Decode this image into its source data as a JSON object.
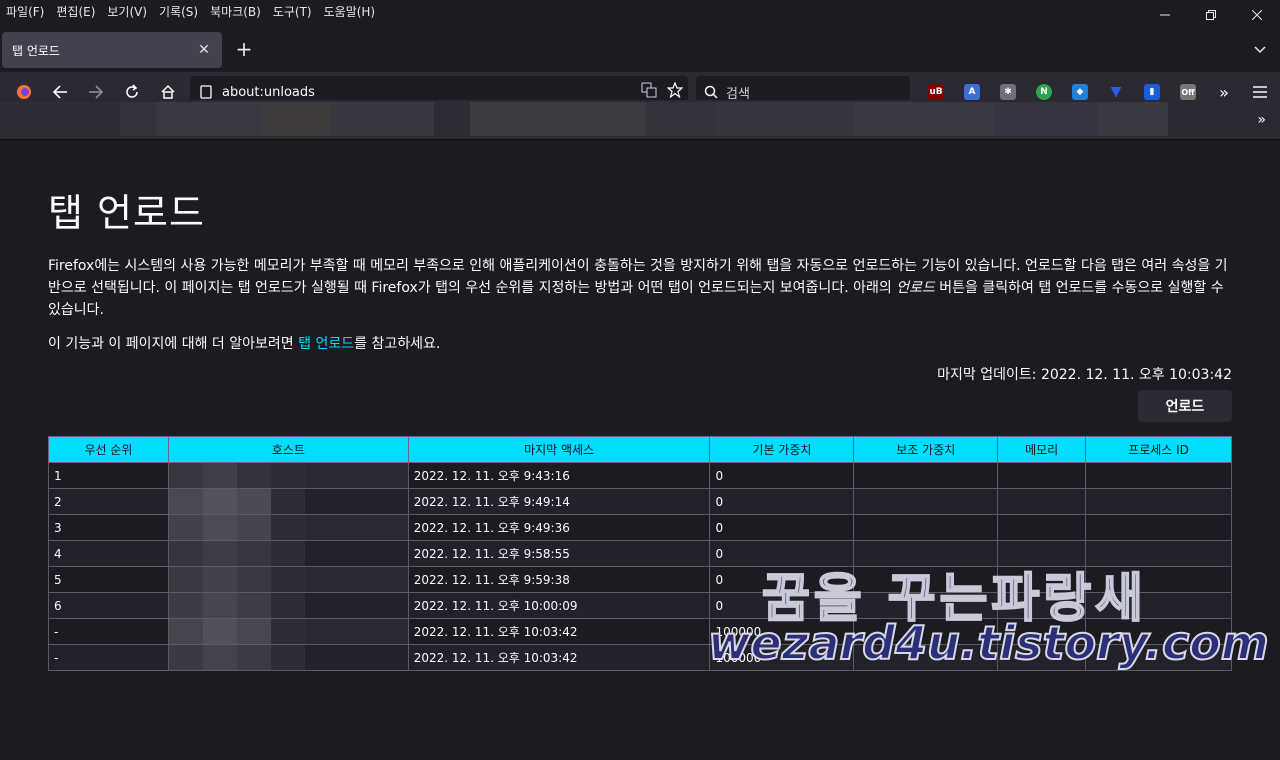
{
  "menu": [
    "파일(F)",
    "편집(E)",
    "보기(V)",
    "기록(S)",
    "북마크(B)",
    "도구(T)",
    "도움말(H)"
  ],
  "tab": {
    "title": "탭 언로드"
  },
  "url": "about:unloads",
  "search": {
    "placeholder": "검색"
  },
  "content": {
    "title": "탭 언로드",
    "desc_before": "Firefox에는 시스템의 사용 가능한 메모리가 부족할 때 메모리 부족으로 인해 애플리케이션이 충돌하는 것을 방지하기 위해 탭을 자동으로 언로드하는 기능이 있습니다. 언로드할 다음 탭은 여러 속성을 기반으로 선택됩니다. 이 페이지는 탭 언로드가 실행될 때 Firefox가 탭의 우선 순위를 지정하는 방법과 어떤 탭이 언로드되는지 보여줍니다. 아래의 ",
    "desc_em": "언로드",
    "desc_after": " 버튼을 클릭하여 탭 언로드를 수동으로 실행할 수 있습니다.",
    "learn_before": "이 기능과 이 페이지에 대해 더 알아보려면 ",
    "learn_link": "탭 언로드",
    "learn_after": "를 참고하세요.",
    "updated": "마지막 업데이트: 2022. 12. 11. 오후 10:03:42",
    "unload_button": "언로드"
  },
  "table": {
    "headers": [
      "우선 순위",
      "호스트",
      "마지막 액세스",
      "기본 가중치",
      "보조 가중치",
      "메모리",
      "프로세스 ID"
    ],
    "rows": [
      [
        "1",
        "",
        "2022. 12. 11. 오후 9:43:16",
        "0",
        "",
        "",
        ""
      ],
      [
        "2",
        "",
        "2022. 12. 11. 오후 9:49:14",
        "0",
        "",
        "",
        ""
      ],
      [
        "3",
        "",
        "2022. 12. 11. 오후 9:49:36",
        "0",
        "",
        "",
        ""
      ],
      [
        "4",
        "",
        "2022. 12. 11. 오후 9:58:55",
        "0",
        "",
        "",
        ""
      ],
      [
        "5",
        "",
        "2022. 12. 11. 오후 9:59:38",
        "0",
        "",
        "",
        ""
      ],
      [
        "6",
        "",
        "2022. 12. 11. 오후 10:00:09",
        "0",
        "",
        "",
        ""
      ],
      [
        "-",
        "",
        "2022. 12. 11. 오후 10:03:42",
        "100000",
        "",
        "",
        ""
      ],
      [
        "-",
        "",
        "2022. 12. 11. 오후 10:03:42",
        "100000",
        "",
        "",
        ""
      ]
    ]
  },
  "watermark": {
    "line1": "꿈을 꾸는파랑새",
    "line2": "wezard4u.tistory.com"
  },
  "extensions": [
    "ublock-icon",
    "translate-icon",
    "puzzle-icon",
    "n-icon",
    "shield-icon",
    "arrow-down-icon",
    "bitwarden-icon",
    "off-icon"
  ],
  "colors": {
    "accent": "#00ddff",
    "background": "#1c1b22",
    "toolbar": "#2b2a33"
  }
}
